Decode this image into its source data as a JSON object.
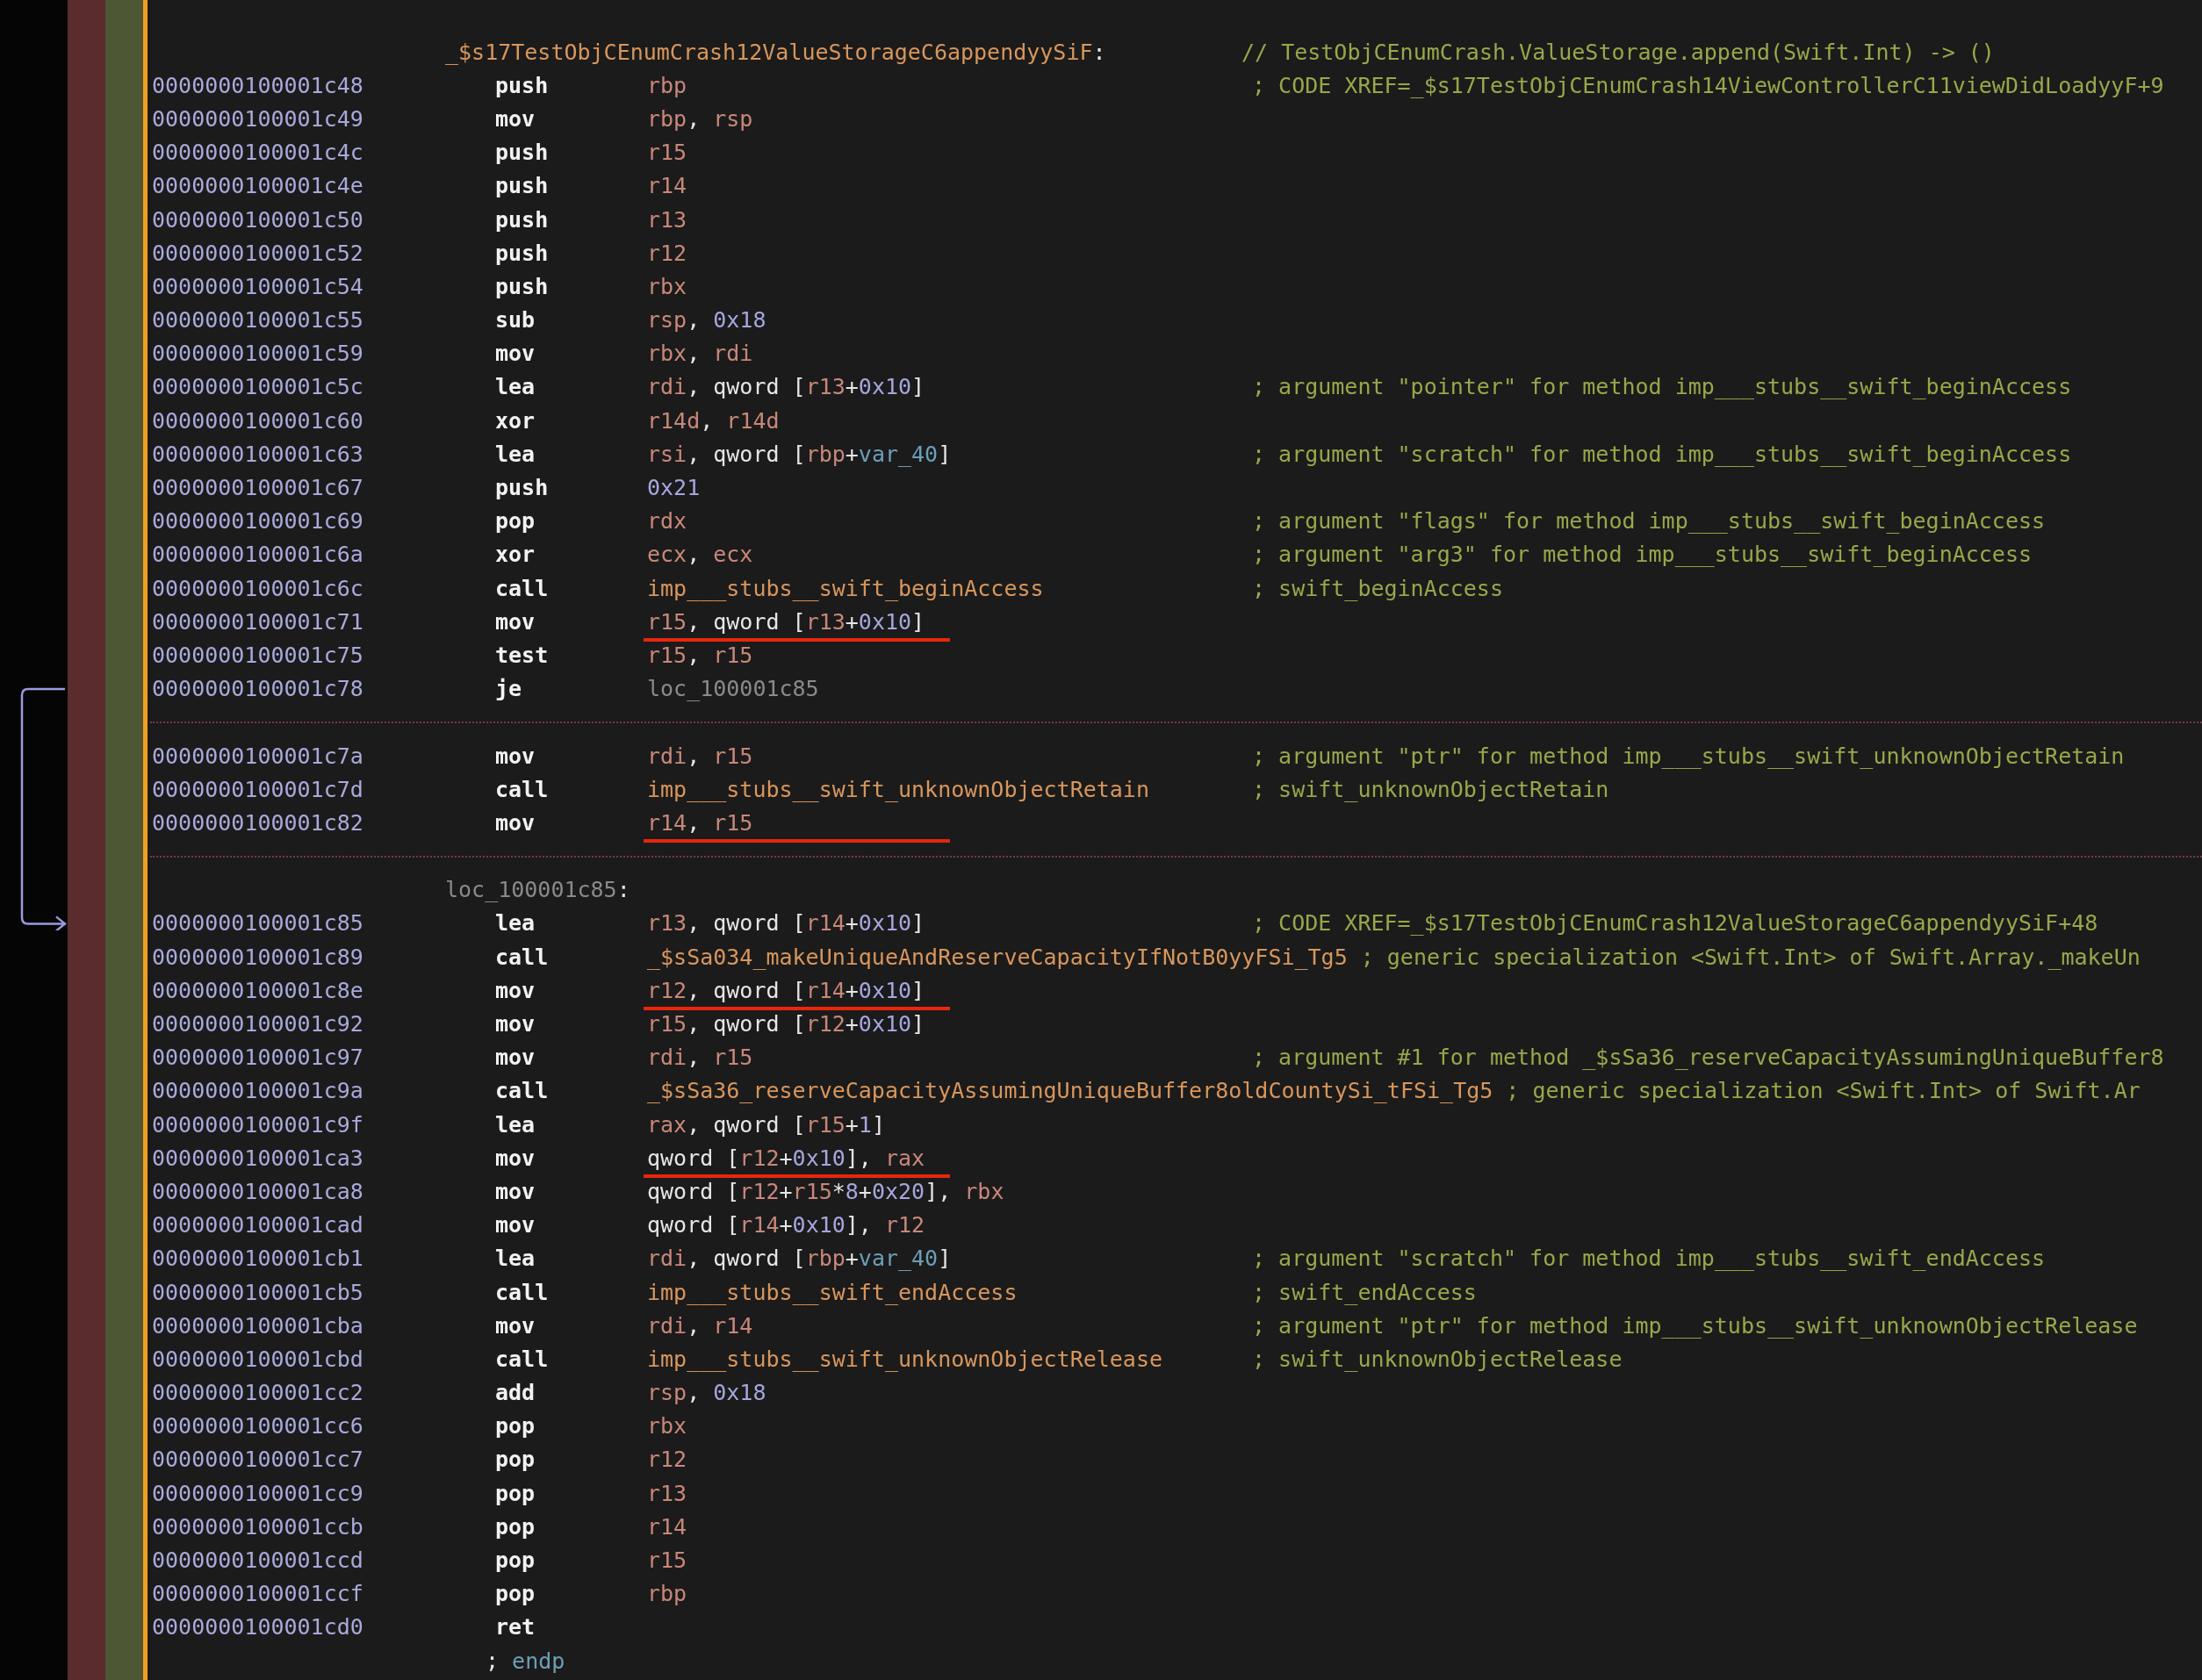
{
  "lines": [
    {
      "kind": "label",
      "tokens": [
        {
          "kind": "func",
          "text": "_$s17TestObjCEnumCrash12ValueStorageC6appendyySiF"
        },
        {
          "kind": "text",
          "text": ":"
        }
      ],
      "comment": "// TestObjCEnumCrash.ValueStorage.append(Swift.Int) -> ()"
    },
    {
      "kind": "instruction",
      "address": "0000000100001c48",
      "mnemonic": "push",
      "operands": [
        {
          "kind": "reg",
          "text": "rbp"
        }
      ],
      "comment": "; CODE XREF=_$s17TestObjCEnumCrash14ViewControllerC11viewDidLoadyyF+9",
      "underlined": false
    },
    {
      "kind": "instruction",
      "address": "0000000100001c49",
      "mnemonic": "mov",
      "operands": [
        {
          "kind": "reg",
          "text": "rbp"
        },
        {
          "kind": "text",
          "text": ", "
        },
        {
          "kind": "reg",
          "text": "rsp"
        }
      ],
      "underlined": false
    },
    {
      "kind": "instruction",
      "address": "0000000100001c4c",
      "mnemonic": "push",
      "operands": [
        {
          "kind": "reg",
          "text": "r15"
        }
      ],
      "underlined": false
    },
    {
      "kind": "instruction",
      "address": "0000000100001c4e",
      "mnemonic": "push",
      "operands": [
        {
          "kind": "reg",
          "text": "r14"
        }
      ],
      "underlined": false
    },
    {
      "kind": "instruction",
      "address": "0000000100001c50",
      "mnemonic": "push",
      "operands": [
        {
          "kind": "reg",
          "text": "r13"
        }
      ],
      "underlined": false
    },
    {
      "kind": "instruction",
      "address": "0000000100001c52",
      "mnemonic": "push",
      "operands": [
        {
          "kind": "reg",
          "text": "r12"
        }
      ],
      "underlined": false
    },
    {
      "kind": "instruction",
      "address": "0000000100001c54",
      "mnemonic": "push",
      "operands": [
        {
          "kind": "reg",
          "text": "rbx"
        }
      ],
      "underlined": false
    },
    {
      "kind": "instruction",
      "address": "0000000100001c55",
      "mnemonic": "sub",
      "operands": [
        {
          "kind": "reg",
          "text": "rsp"
        },
        {
          "kind": "text",
          "text": ", "
        },
        {
          "kind": "num",
          "text": "0x18"
        }
      ],
      "underlined": false
    },
    {
      "kind": "instruction",
      "address": "0000000100001c59",
      "mnemonic": "mov",
      "operands": [
        {
          "kind": "reg",
          "text": "rbx"
        },
        {
          "kind": "text",
          "text": ", "
        },
        {
          "kind": "reg",
          "text": "rdi"
        }
      ],
      "underlined": false
    },
    {
      "kind": "instruction",
      "address": "0000000100001c5c",
      "mnemonic": "lea",
      "operands": [
        {
          "kind": "reg",
          "text": "rdi"
        },
        {
          "kind": "text",
          "text": ", qword ["
        },
        {
          "kind": "reg",
          "text": "r13"
        },
        {
          "kind": "text",
          "text": "+"
        },
        {
          "kind": "num",
          "text": "0x10"
        },
        {
          "kind": "text",
          "text": "]"
        }
      ],
      "comment": "; argument \"pointer\" for method imp___stubs__swift_beginAccess",
      "underlined": false
    },
    {
      "kind": "instruction",
      "address": "0000000100001c60",
      "mnemonic": "xor",
      "operands": [
        {
          "kind": "reg",
          "text": "r14d"
        },
        {
          "kind": "text",
          "text": ", "
        },
        {
          "kind": "reg",
          "text": "r14d"
        }
      ],
      "underlined": false
    },
    {
      "kind": "instruction",
      "address": "0000000100001c63",
      "mnemonic": "lea",
      "operands": [
        {
          "kind": "reg",
          "text": "rsi"
        },
        {
          "kind": "text",
          "text": ", qword ["
        },
        {
          "kind": "reg",
          "text": "rbp"
        },
        {
          "kind": "text",
          "text": "+"
        },
        {
          "kind": "var",
          "text": "var_40"
        },
        {
          "kind": "text",
          "text": "]"
        }
      ],
      "comment": "; argument \"scratch\" for method imp___stubs__swift_beginAccess",
      "underlined": false
    },
    {
      "kind": "instruction",
      "address": "0000000100001c67",
      "mnemonic": "push",
      "operands": [
        {
          "kind": "num",
          "text": "0x21"
        }
      ],
      "underlined": false
    },
    {
      "kind": "instruction",
      "address": "0000000100001c69",
      "mnemonic": "pop",
      "operands": [
        {
          "kind": "reg",
          "text": "rdx"
        }
      ],
      "comment": "; argument \"flags\" for method imp___stubs__swift_beginAccess",
      "underlined": false
    },
    {
      "kind": "instruction",
      "address": "0000000100001c6a",
      "mnemonic": "xor",
      "operands": [
        {
          "kind": "reg",
          "text": "ecx"
        },
        {
          "kind": "text",
          "text": ", "
        },
        {
          "kind": "reg",
          "text": "ecx"
        }
      ],
      "comment": "; argument \"arg3\" for method imp___stubs__swift_beginAccess",
      "underlined": false
    },
    {
      "kind": "instruction",
      "address": "0000000100001c6c",
      "mnemonic": "call",
      "operands": [
        {
          "kind": "func",
          "text": "imp___stubs__swift_beginAccess"
        }
      ],
      "comment": "; swift_beginAccess",
      "underlined": false
    },
    {
      "kind": "instruction",
      "address": "0000000100001c71",
      "mnemonic": "mov",
      "operands": [
        {
          "kind": "reg",
          "text": "r15"
        },
        {
          "kind": "text",
          "text": ", qword ["
        },
        {
          "kind": "reg",
          "text": "r13"
        },
        {
          "kind": "text",
          "text": "+"
        },
        {
          "kind": "num",
          "text": "0x10"
        },
        {
          "kind": "text",
          "text": "]"
        }
      ],
      "underlined": true
    },
    {
      "kind": "instruction",
      "address": "0000000100001c75",
      "mnemonic": "test",
      "operands": [
        {
          "kind": "reg",
          "text": "r15"
        },
        {
          "kind": "text",
          "text": ", "
        },
        {
          "kind": "reg",
          "text": "r15"
        }
      ],
      "underlined": false
    },
    {
      "kind": "instruction",
      "address": "0000000100001c78",
      "mnemonic": "je",
      "operands": [
        {
          "kind": "loc",
          "text": "loc_100001c85"
        }
      ],
      "underlined": false
    },
    {
      "kind": "separator"
    },
    {
      "kind": "instruction",
      "address": "0000000100001c7a",
      "mnemonic": "mov",
      "operands": [
        {
          "kind": "reg",
          "text": "rdi"
        },
        {
          "kind": "text",
          "text": ", "
        },
        {
          "kind": "reg",
          "text": "r15"
        }
      ],
      "comment": "; argument \"ptr\" for method imp___stubs__swift_unknownObjectRetain",
      "underlined": false
    },
    {
      "kind": "instruction",
      "address": "0000000100001c7d",
      "mnemonic": "call",
      "operands": [
        {
          "kind": "func",
          "text": "imp___stubs__swift_unknownObjectRetain"
        }
      ],
      "comment": "; swift_unknownObjectRetain",
      "underlined": false
    },
    {
      "kind": "instruction",
      "address": "0000000100001c82",
      "mnemonic": "mov",
      "operands": [
        {
          "kind": "reg",
          "text": "r14"
        },
        {
          "kind": "text",
          "text": ", "
        },
        {
          "kind": "reg",
          "text": "r15"
        }
      ],
      "underlined": true
    },
    {
      "kind": "separator"
    },
    {
      "kind": "label",
      "tokens": [
        {
          "kind": "loc",
          "text": "loc_100001c85"
        },
        {
          "kind": "text",
          "text": ":"
        }
      ]
    },
    {
      "kind": "instruction",
      "address": "0000000100001c85",
      "mnemonic": "lea",
      "operands": [
        {
          "kind": "reg",
          "text": "r13"
        },
        {
          "kind": "text",
          "text": ", qword ["
        },
        {
          "kind": "reg",
          "text": "r14"
        },
        {
          "kind": "text",
          "text": "+"
        },
        {
          "kind": "num",
          "text": "0x10"
        },
        {
          "kind": "text",
          "text": "]"
        }
      ],
      "comment": "; CODE XREF=_$s17TestObjCEnumCrash12ValueStorageC6appendyySiF+48",
      "underlined": false
    },
    {
      "kind": "instruction",
      "address": "0000000100001c89",
      "mnemonic": "call",
      "operands": [
        {
          "kind": "func",
          "text": "_$sSa034_makeUniqueAndReserveCapacityIfNotB0yyFSi_Tg5"
        }
      ],
      "comment": "; generic specialization <Swift.Int> of Swift.Array._makeUn",
      "underlined": false
    },
    {
      "kind": "instruction",
      "address": "0000000100001c8e",
      "mnemonic": "mov",
      "operands": [
        {
          "kind": "reg",
          "text": "r12"
        },
        {
          "kind": "text",
          "text": ", qword ["
        },
        {
          "kind": "reg",
          "text": "r14"
        },
        {
          "kind": "text",
          "text": "+"
        },
        {
          "kind": "num",
          "text": "0x10"
        },
        {
          "kind": "text",
          "text": "]"
        }
      ],
      "underlined": true
    },
    {
      "kind": "instruction",
      "address": "0000000100001c92",
      "mnemonic": "mov",
      "operands": [
        {
          "kind": "reg",
          "text": "r15"
        },
        {
          "kind": "text",
          "text": ", qword ["
        },
        {
          "kind": "reg",
          "text": "r12"
        },
        {
          "kind": "text",
          "text": "+"
        },
        {
          "kind": "num",
          "text": "0x10"
        },
        {
          "kind": "text",
          "text": "]"
        }
      ],
      "underlined": false
    },
    {
      "kind": "instruction",
      "address": "0000000100001c97",
      "mnemonic": "mov",
      "operands": [
        {
          "kind": "reg",
          "text": "rdi"
        },
        {
          "kind": "text",
          "text": ", "
        },
        {
          "kind": "reg",
          "text": "r15"
        }
      ],
      "comment": "; argument #1 for method _$sSa36_reserveCapacityAssumingUniqueBuffer8",
      "underlined": false
    },
    {
      "kind": "instruction",
      "address": "0000000100001c9a",
      "mnemonic": "call",
      "operands": [
        {
          "kind": "func",
          "text": "_$sSa36_reserveCapacityAssumingUniqueBuffer8oldCountySi_tFSi_Tg5"
        }
      ],
      "comment": "; generic specialization <Swift.Int> of Swift.Ar",
      "underlined": false
    },
    {
      "kind": "instruction",
      "address": "0000000100001c9f",
      "mnemonic": "lea",
      "operands": [
        {
          "kind": "reg",
          "text": "rax"
        },
        {
          "kind": "text",
          "text": ", qword ["
        },
        {
          "kind": "reg",
          "text": "r15"
        },
        {
          "kind": "text",
          "text": "+"
        },
        {
          "kind": "num",
          "text": "1"
        },
        {
          "kind": "text",
          "text": "]"
        }
      ],
      "underlined": false
    },
    {
      "kind": "instruction",
      "address": "0000000100001ca3",
      "mnemonic": "mov",
      "operands": [
        {
          "kind": "text",
          "text": "qword ["
        },
        {
          "kind": "reg",
          "text": "r12"
        },
        {
          "kind": "text",
          "text": "+"
        },
        {
          "kind": "num",
          "text": "0x10"
        },
        {
          "kind": "text",
          "text": "], "
        },
        {
          "kind": "reg",
          "text": "rax"
        }
      ],
      "underlined": true
    },
    {
      "kind": "instruction",
      "address": "0000000100001ca8",
      "mnemonic": "mov",
      "operands": [
        {
          "kind": "text",
          "text": "qword ["
        },
        {
          "kind": "reg",
          "text": "r12"
        },
        {
          "kind": "text",
          "text": "+"
        },
        {
          "kind": "reg",
          "text": "r15"
        },
        {
          "kind": "text",
          "text": "*"
        },
        {
          "kind": "num",
          "text": "8"
        },
        {
          "kind": "text",
          "text": "+"
        },
        {
          "kind": "num",
          "text": "0x20"
        },
        {
          "kind": "text",
          "text": "], "
        },
        {
          "kind": "reg",
          "text": "rbx"
        }
      ],
      "underlined": false
    },
    {
      "kind": "instruction",
      "address": "0000000100001cad",
      "mnemonic": "mov",
      "operands": [
        {
          "kind": "text",
          "text": "qword ["
        },
        {
          "kind": "reg",
          "text": "r14"
        },
        {
          "kind": "text",
          "text": "+"
        },
        {
          "kind": "num",
          "text": "0x10"
        },
        {
          "kind": "text",
          "text": "], "
        },
        {
          "kind": "reg",
          "text": "r12"
        }
      ],
      "underlined": false
    },
    {
      "kind": "instruction",
      "address": "0000000100001cb1",
      "mnemonic": "lea",
      "operands": [
        {
          "kind": "reg",
          "text": "rdi"
        },
        {
          "kind": "text",
          "text": ", qword ["
        },
        {
          "kind": "reg",
          "text": "rbp"
        },
        {
          "kind": "text",
          "text": "+"
        },
        {
          "kind": "var",
          "text": "var_40"
        },
        {
          "kind": "text",
          "text": "]"
        }
      ],
      "comment": "; argument \"scratch\" for method imp___stubs__swift_endAccess",
      "underlined": false
    },
    {
      "kind": "instruction",
      "address": "0000000100001cb5",
      "mnemonic": "call",
      "operands": [
        {
          "kind": "func",
          "text": "imp___stubs__swift_endAccess"
        }
      ],
      "comment": "; swift_endAccess",
      "underlined": false
    },
    {
      "kind": "instruction",
      "address": "0000000100001cba",
      "mnemonic": "mov",
      "operands": [
        {
          "kind": "reg",
          "text": "rdi"
        },
        {
          "kind": "text",
          "text": ", "
        },
        {
          "kind": "reg",
          "text": "r14"
        }
      ],
      "comment": "; argument \"ptr\" for method imp___stubs__swift_unknownObjectRelease",
      "underlined": false
    },
    {
      "kind": "instruction",
      "address": "0000000100001cbd",
      "mnemonic": "call",
      "operands": [
        {
          "kind": "func",
          "text": "imp___stubs__swift_unknownObjectRelease"
        }
      ],
      "comment": "; swift_unknownObjectRelease",
      "underlined": false
    },
    {
      "kind": "instruction",
      "address": "0000000100001cc2",
      "mnemonic": "add",
      "operands": [
        {
          "kind": "reg",
          "text": "rsp"
        },
        {
          "kind": "text",
          "text": ", "
        },
        {
          "kind": "num",
          "text": "0x18"
        }
      ],
      "underlined": false
    },
    {
      "kind": "instruction",
      "address": "0000000100001cc6",
      "mnemonic": "pop",
      "operands": [
        {
          "kind": "reg",
          "text": "rbx"
        }
      ],
      "underlined": false
    },
    {
      "kind": "instruction",
      "address": "0000000100001cc7",
      "mnemonic": "pop",
      "operands": [
        {
          "kind": "reg",
          "text": "r12"
        }
      ],
      "underlined": false
    },
    {
      "kind": "instruction",
      "address": "0000000100001cc9",
      "mnemonic": "pop",
      "operands": [
        {
          "kind": "reg",
          "text": "r13"
        }
      ],
      "underlined": false
    },
    {
      "kind": "instruction",
      "address": "0000000100001ccb",
      "mnemonic": "pop",
      "operands": [
        {
          "kind": "reg",
          "text": "r14"
        }
      ],
      "underlined": false
    },
    {
      "kind": "instruction",
      "address": "0000000100001ccd",
      "mnemonic": "pop",
      "operands": [
        {
          "kind": "reg",
          "text": "r15"
        }
      ],
      "underlined": false
    },
    {
      "kind": "instruction",
      "address": "0000000100001ccf",
      "mnemonic": "pop",
      "operands": [
        {
          "kind": "reg",
          "text": "rbp"
        }
      ],
      "underlined": false
    },
    {
      "kind": "instruction",
      "address": "0000000100001cd0",
      "mnemonic": "ret"
    },
    {
      "kind": "directive",
      "tokens": [
        {
          "kind": "text",
          "text": "; "
        },
        {
          "kind": "var",
          "text": "endp"
        }
      ]
    }
  ]
}
